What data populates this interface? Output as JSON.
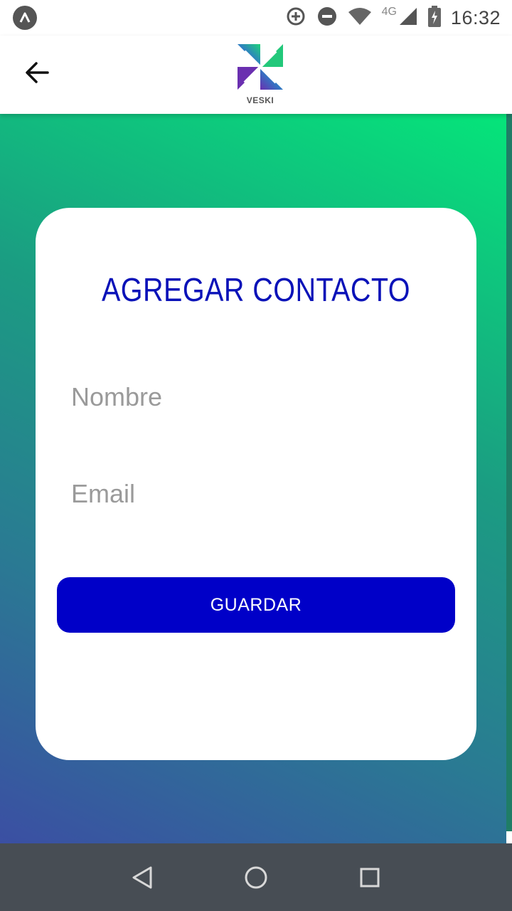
{
  "status_bar": {
    "time": "16:32",
    "network_type": "4G",
    "icons": [
      "app-notification-icon",
      "data-saver-icon",
      "do-not-disturb-icon",
      "wifi-icon",
      "signal-icon",
      "battery-charging-icon"
    ]
  },
  "app_bar": {
    "back_icon": "arrow-back-icon",
    "logo_text": "VESKI"
  },
  "form": {
    "title": "AGREGAR CONTACTO",
    "name_placeholder": "Nombre",
    "email_placeholder": "Email",
    "save_label": "GUARDAR"
  },
  "nav_bar": {
    "icons": [
      "back-triangle-icon",
      "home-circle-icon",
      "recents-square-icon"
    ]
  },
  "colors": {
    "accent": "#0000c8",
    "title": "#0a12b8",
    "gradient_start": "#3b4fa3",
    "gradient_end": "#05e57a",
    "nav_bar": "#474d54"
  }
}
